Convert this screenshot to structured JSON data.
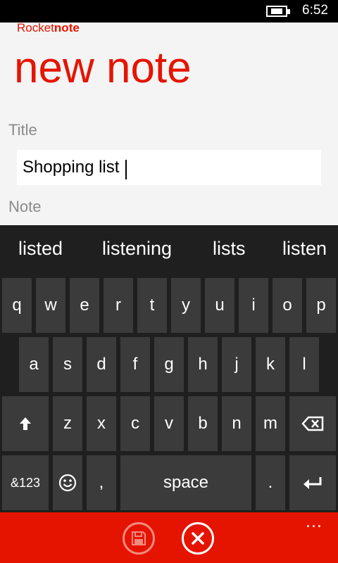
{
  "status": {
    "time": "6:52"
  },
  "app": {
    "name_prefix": "Rocket",
    "name_suffix": "note",
    "page_title": "new note"
  },
  "form": {
    "title_label": "Title",
    "title_value": "Shopping list",
    "note_label": "Note"
  },
  "suggestions": [
    "listed",
    "listening",
    "lists",
    "listen"
  ],
  "keyboard": {
    "row1": [
      "q",
      "w",
      "e",
      "r",
      "t",
      "y",
      "u",
      "i",
      "o",
      "p"
    ],
    "row2": [
      "a",
      "s",
      "d",
      "f",
      "g",
      "h",
      "j",
      "k",
      "l"
    ],
    "row3": [
      "z",
      "x",
      "c",
      "v",
      "b",
      "n",
      "m"
    ],
    "symbols": "&123",
    "comma": ",",
    "space": "space",
    "period": "."
  },
  "appbar": {
    "save_icon": "save-icon",
    "cancel_icon": "close-icon",
    "more": "..."
  },
  "colors": {
    "accent": "#e51400"
  }
}
